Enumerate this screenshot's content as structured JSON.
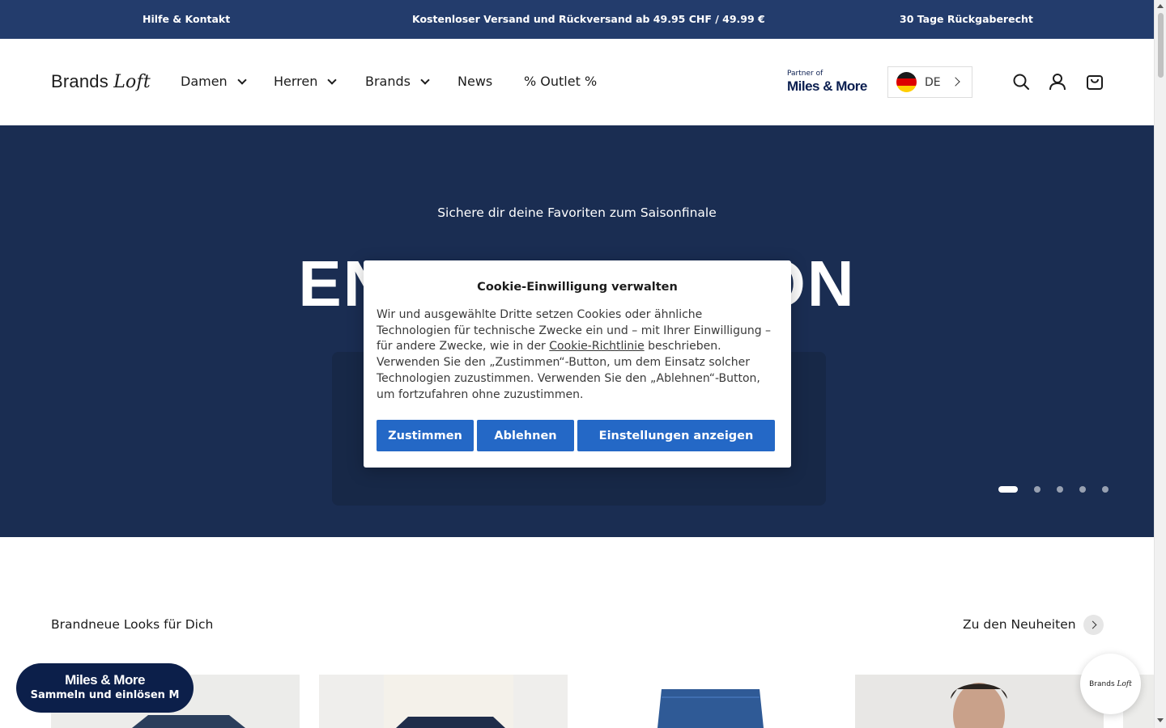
{
  "announcement": {
    "help": "Hilfe & Kontakt",
    "shipping": "Kostenloser Versand und Rückversand ab 49.95 CHF / 49.99 €",
    "returns": "30 Tage Rückgaberecht"
  },
  "header": {
    "logo_brands": "Brands",
    "logo_loft": "Loft",
    "nav": [
      "Damen",
      "Herren",
      "Brands",
      "News",
      "% Outlet %"
    ],
    "partner_small": "Partner of",
    "partner_big": "Miles & More",
    "language": "DE",
    "icons": [
      "search-icon",
      "account-icon",
      "cart-icon"
    ]
  },
  "hero": {
    "subtitle": "Sichere dir deine Favoriten zum Saisonfinale",
    "title": "END OF SEASON",
    "slides": 5,
    "active_slide": 1
  },
  "cookie": {
    "title": "Cookie-Einwilligung verwalten",
    "text_before": "Wir und ausgewählte Dritte setzen Cookies oder ähnliche Technologien für technische Zwecke ein und – mit Ihrer Einwilligung – für andere Zwecke, wie in der ",
    "link": "Cookie-Richtlinie",
    "text_after": " beschrieben. Verwenden Sie den „Zustimmen“-Button, um dem Einsatz solcher Technologien zuzustimmen. Verwenden Sie den „Ablehnen“-Button, um fortzufahren ohne zuzustimmen.",
    "accept": "Zustimmen",
    "reject": "Ablehnen",
    "settings": "Einstellungen anzeigen"
  },
  "section": {
    "title": "Brandneue Looks für Dich",
    "link": "Zu den Neuheiten"
  },
  "miles_badge": {
    "line1": "Miles & More",
    "line2": "Sammeln und einlösen"
  },
  "colors": {
    "announcement_bg": "#233c6c",
    "hero_bg": "#1a2d52",
    "button_blue": "#2468c6",
    "miles_navy": "#0c1f4a"
  }
}
